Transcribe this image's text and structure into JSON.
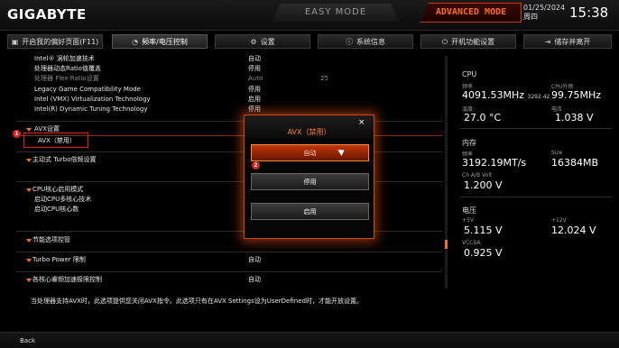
{
  "header": {
    "logo": "GIGABYTE",
    "easy_mode": "EASY MODE",
    "advanced_mode": "ADVANCED MODE",
    "date": "01/25/2024",
    "weekday": "周四",
    "time": "15:38"
  },
  "tabs": [
    {
      "label": "开启我的偏好页面(F11)",
      "icon": "monitor-icon"
    },
    {
      "label": "频率/电压控制",
      "icon": "speedometer-icon"
    },
    {
      "label": "设置",
      "icon": "gear-icon"
    },
    {
      "label": "系统信息",
      "icon": "info-icon"
    },
    {
      "label": "开机功能设置",
      "icon": "power-icon"
    },
    {
      "label": "储存并离开",
      "icon": "exit-icon"
    }
  ],
  "rows": [
    {
      "label": "Intel® 涡轮加速技术",
      "value": "自动"
    },
    {
      "label": "处理器动态Ratio值覆盖",
      "value": "停用"
    },
    {
      "label": "处理器 Flex Ratio设置",
      "value": "Auto",
      "value2": "25"
    },
    {
      "label": "Legacy Game Compatibility Mode",
      "value": "停用"
    },
    {
      "label": "Intel (VMX) Virtualization Technology",
      "value": "启用"
    },
    {
      "label": "Intel(R) Dynamic Tuning Technology",
      "value": "停用"
    },
    {
      "label": "AVX设置"
    },
    {
      "label": "AVX（禁用）"
    },
    {
      "label": "主动式 Turbo倍频设置"
    },
    {
      "label": "CPU核心启用模式"
    },
    {
      "label": "启动CPU多核心技术"
    },
    {
      "label": "启动CPU核心数"
    },
    {
      "label": "节能选项控管"
    },
    {
      "label": "Turbo Power 限制",
      "value": "自动"
    },
    {
      "label": "各核心睿频加速极限控制",
      "value": "自动"
    }
  ],
  "markers": {
    "one": "1",
    "two": "2"
  },
  "panel": {
    "cpu": {
      "title": "CPU",
      "freq_label": "频率",
      "freq_value": "4091.53MHz",
      "freq_sub": "3292.42",
      "ext_label": "CPU外频",
      "ext_value": "99.75MHz",
      "temp_label": "温度",
      "temp_value": "27.0 °C",
      "volt_label": "电压",
      "volt_value": "1.038 V"
    },
    "memory": {
      "title": "内存",
      "freq_label": "频率",
      "freq_value": "3192.19MT/s",
      "size_label": "Size",
      "size_value": "16384MB",
      "volt_label": "Ch A/B Volt",
      "volt_value": "1.200 V"
    },
    "voltage": {
      "title": "电压",
      "v5_label": "+5V",
      "v5_value": "5.115 V",
      "v12_label": "+12V",
      "v12_value": "12.024 V",
      "vccsa_label": "VCCSA",
      "vccsa_value": "0.925 V"
    }
  },
  "dialog": {
    "title": "AVX（禁用）",
    "close": "×",
    "options": [
      "自动",
      "停用",
      "启用"
    ],
    "selected": 0
  },
  "help_text": "当处理器支持AVX时，此选项提供您关闭AVX指令。此选项只有在AVX Settings设为UserDefined时，才能开放设置。",
  "footer": {
    "back": "Back"
  },
  "colors": {
    "accent": "#ff6a1f",
    "marker": "#e0211a",
    "background": "#000000"
  }
}
